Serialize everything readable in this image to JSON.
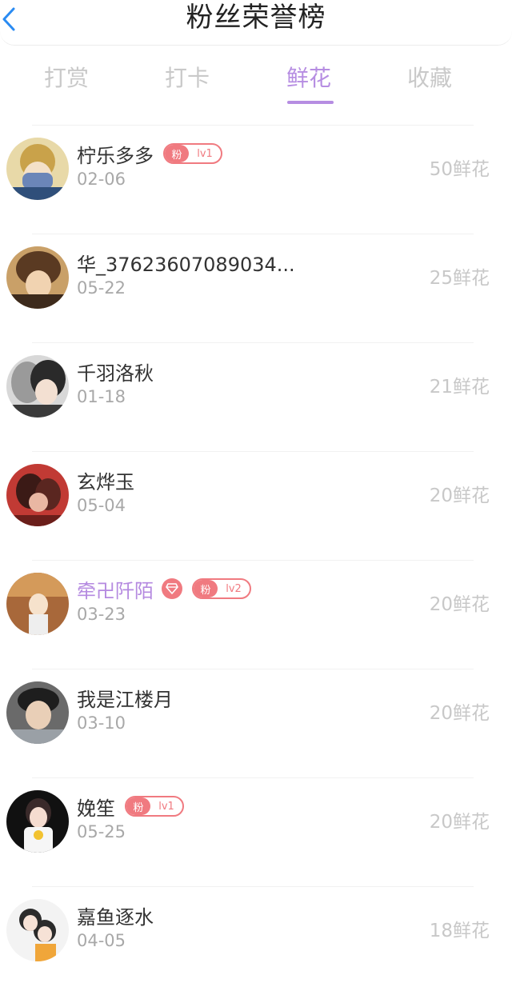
{
  "header": {
    "title": "粉丝荣誉榜",
    "back_icon": "chevron-left-icon"
  },
  "tabs": [
    {
      "label": "打赏",
      "active": false
    },
    {
      "label": "打卡",
      "active": false
    },
    {
      "label": "鲜花",
      "active": true
    },
    {
      "label": "收藏",
      "active": false
    }
  ],
  "accent_color": "#b68de2",
  "badge_color": "#f07a80",
  "rows": [
    {
      "name": "柠乐多多",
      "date": "02-06",
      "count": "50鲜花",
      "fan_label": "粉",
      "level": "lv1"
    },
    {
      "name": "华_37623607089034...",
      "date": "05-22",
      "count": "25鲜花"
    },
    {
      "name": "千羽洛秋",
      "date": "01-18",
      "count": "21鲜花"
    },
    {
      "name": "玄烨玉",
      "date": "05-04",
      "count": "20鲜花"
    },
    {
      "name": "牵卍阡陌",
      "date": "03-23",
      "count": "20鲜花",
      "fan_label": "粉",
      "level": "lv2",
      "vip_icon": "diamond-icon"
    },
    {
      "name": "我是江楼月",
      "date": "03-10",
      "count": "20鲜花"
    },
    {
      "name": "娩笙",
      "date": "05-25",
      "count": "20鲜花",
      "fan_label": "粉",
      "level": "lv1"
    },
    {
      "name": "嘉鱼逐水",
      "date": "04-05",
      "count": "18鲜花"
    }
  ]
}
